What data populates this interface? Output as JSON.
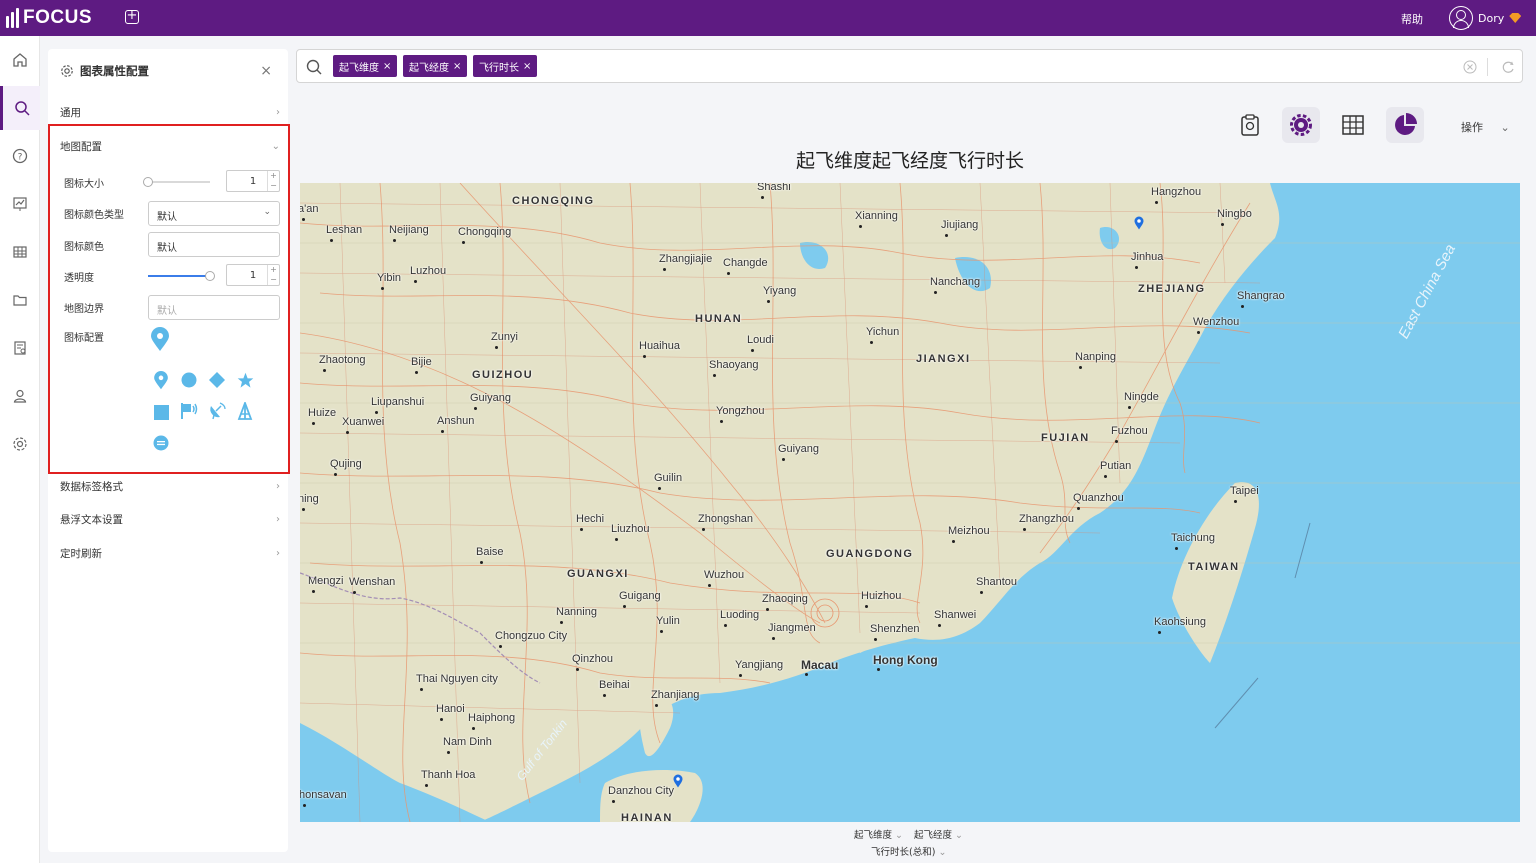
{
  "app": {
    "name": "FOCUS",
    "help": "帮助",
    "user": "Dory"
  },
  "nav": [
    "home-icon",
    "search-icon",
    "question-icon",
    "dashboard-icon",
    "table-icon",
    "folder-icon",
    "report-icon",
    "user-icon",
    "settings-icon"
  ],
  "panel": {
    "title": "图表属性配置",
    "sections": {
      "general": "通用",
      "map_config": "地图配置",
      "label_format": "数据标签格式",
      "hover_text": "悬浮文本设置",
      "timer": "定时刷新"
    },
    "map": {
      "icon_size_label": "图标大小",
      "icon_size_value": "1",
      "icon_color_type_label": "图标颜色类型",
      "icon_color_type_value": "默认",
      "icon_color_label": "图标颜色",
      "icon_color_value": "默认",
      "opacity_label": "透明度",
      "opacity_value": "1",
      "opacity_level": 1.0,
      "icon_size_level": 0.0,
      "border_label": "地图边界",
      "border_placeholder": "默认",
      "icon_config_label": "图标配置",
      "selected_icon": "map-pin-icon",
      "icons": [
        "map-pin-icon",
        "circle-icon",
        "diamond-icon",
        "star-icon",
        "square-icon",
        "flag-icon",
        "satellite-icon",
        "tower-icon",
        "ring-icon"
      ],
      "icon_color": "#5bb8e8"
    }
  },
  "search": {
    "tokens": [
      "起飞维度",
      "起飞经度",
      "飞行时长"
    ]
  },
  "toolbar": {
    "operation": "操作"
  },
  "chart": {
    "title": "起飞维度起飞经度飞行时长",
    "legend_x1": "起飞维度",
    "legend_x2": "起飞经度",
    "legend_y": "飞行时长(总和)"
  },
  "map_labels": {
    "provinces": [
      "CHONGQING",
      "HUNAN",
      "GUIZHOU",
      "JIANGXI",
      "ZHEJIANG",
      "FUJIAN",
      "GUANGDONG",
      "GUANGXI",
      "TAIWAN",
      "HAINAN"
    ],
    "cities": [
      "Shashi",
      "Hangzhou",
      "Ningbo",
      "Xianning",
      "Jiujiang",
      "Leshan",
      "Neijiang",
      "Chongqing",
      "Zhangjiajie",
      "Changde",
      "Jinhua",
      "Nanchang",
      "Yibin",
      "Luzhou",
      "Yiyang",
      "Shangrao",
      "Wenzhou",
      "Loudi",
      "Yichun",
      "Zunyi",
      "Huaihua",
      "Zhaotong",
      "Bijie",
      "Shaoyang",
      "Nanping",
      "Ningde",
      "Liupanshui",
      "Guiyang",
      "Yongzhou",
      "Huize",
      "Xuanwei",
      "Anshun",
      "Fuzhou",
      "Guiyang",
      "Putian",
      "Qujing",
      "Guilin",
      "Taipei",
      "Quanzhou",
      "Hechi",
      "Liuzhou",
      "Zhongshan",
      "Meizhou",
      "Zhangzhou",
      "Taichung",
      "Baise",
      "Wuzhou",
      "Shantou",
      "Mengzi",
      "Wenshan",
      "Guigang",
      "Zhaoqing",
      "Huizhou",
      "Nanning",
      "Luoding",
      "Jiangmen",
      "Yulin",
      "Shenzhen",
      "Shanwei",
      "Kaohsiung",
      "Chongzuo City",
      "Qinzhou",
      "Macau",
      "Hong Kong",
      "Yangjiang",
      "Beihai",
      "Thai Nguyen city",
      "Zhanjiang",
      "Hanoi",
      "Haiphong",
      "Nam Dinh",
      "Thanh Hoa",
      "Danzhou City",
      "honsavan",
      "ning",
      "a'an"
    ],
    "seas": [
      "East China Sea",
      "Gulf of Tonkin"
    ]
  },
  "colors": {
    "brand": "#5e1b82",
    "water": "#7ecbee",
    "land": "#e4e2c8",
    "pin": "#1f6fe0",
    "highlight": "#e02020"
  }
}
